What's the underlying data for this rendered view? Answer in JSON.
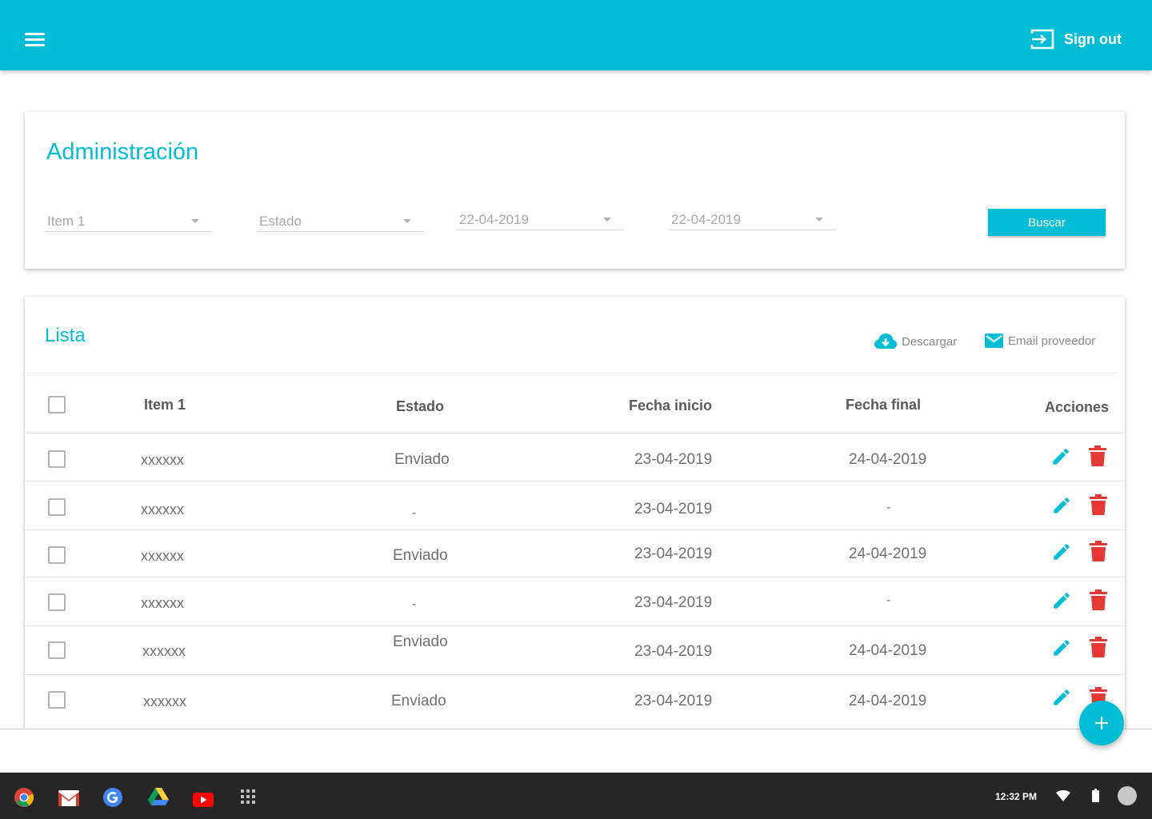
{
  "topbar": {
    "signout_label": "Sign out",
    "color": "#00bcd4"
  },
  "admin": {
    "title": "Administración",
    "filters": [
      {
        "value": "Item 1"
      },
      {
        "value": "Estado"
      },
      {
        "value": "22-04-2019"
      },
      {
        "value": "22-04-2019"
      }
    ],
    "search_label": "Buscar"
  },
  "list": {
    "title": "Lista",
    "download_label": "Descargar",
    "email_label": "Email proveedor",
    "columns": [
      "Item 1",
      "Estado",
      "Fecha inicio",
      "Fecha final",
      "Acciones"
    ],
    "rows": [
      {
        "item": "xxxxxx",
        "estado": "Enviado",
        "inicio": "23-04-2019",
        "final": "24-04-2019"
      },
      {
        "item": "xxxxxx",
        "estado": "-",
        "inicio": "23-04-2019",
        "final": "-"
      },
      {
        "item": "xxxxxx",
        "estado": "Enviado",
        "inicio": "23-04-2019",
        "final": "24-04-2019"
      },
      {
        "item": "xxxxxx",
        "estado": "-",
        "inicio": "23-04-2019",
        "final": "-"
      },
      {
        "item": "xxxxxx",
        "estado": "Enviado",
        "inicio": "23-04-2019",
        "final": "24-04-2019"
      },
      {
        "item": "xxxxxx",
        "estado": "Enviado",
        "inicio": "23-04-2019",
        "final": "24-04-2019"
      }
    ]
  },
  "colors": {
    "accent": "#00bcd4",
    "delete": "#e53935"
  },
  "shelf": {
    "apps": [
      "chrome-icon",
      "gmail-icon",
      "google-icon",
      "drive-icon",
      "youtube-icon",
      "app-launcher-icon"
    ],
    "time": "12:32 PM"
  }
}
